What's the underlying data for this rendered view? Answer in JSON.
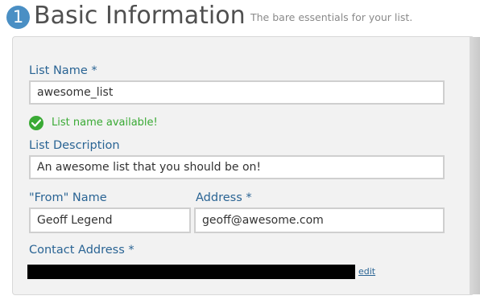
{
  "header": {
    "step_number": "1",
    "title": "Basic Information",
    "subtitle": "The bare essentials for your list."
  },
  "form": {
    "list_name": {
      "label": "List Name *",
      "value": "awesome_list"
    },
    "availability": {
      "icon": "check-circle-icon",
      "text": "List name available!",
      "color": "#3aaa35"
    },
    "list_description": {
      "label": "List Description",
      "value": "An awesome list that you should be on!"
    },
    "from_name": {
      "label": "\"From\" Name",
      "value": "Geoff Legend"
    },
    "address": {
      "label": "Address *",
      "value": "geoff@awesome.com"
    },
    "contact_address": {
      "label": "Contact Address *",
      "edit_label": "edit"
    }
  },
  "colors": {
    "accent": "#4a8fc4",
    "label": "#2a6494",
    "panel_bg": "#f2f2f2"
  }
}
